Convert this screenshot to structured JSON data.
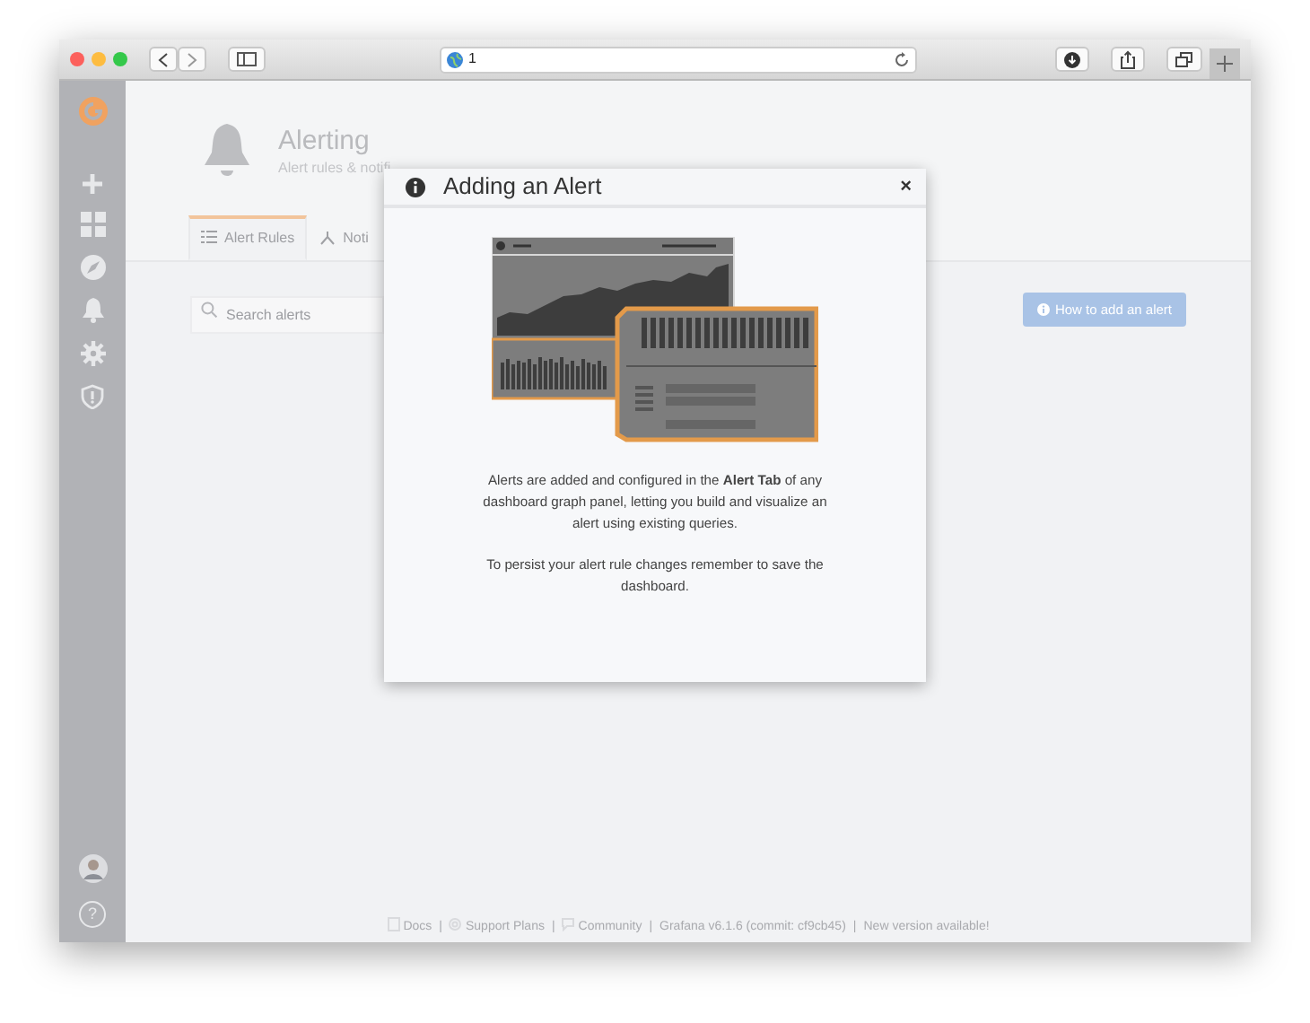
{
  "browser": {
    "url": "1"
  },
  "sidebar": {
    "help": "?"
  },
  "page": {
    "title": "Alerting",
    "subtitle": "Alert rules & notifi",
    "tabs": [
      {
        "label": "Alert Rules",
        "selected": true,
        "kind": "list"
      },
      {
        "label": "Noti",
        "selected": false,
        "kind": "channels"
      }
    ],
    "search": {
      "placeholder": "Search alerts"
    },
    "help_button": "How to add an alert"
  },
  "modal": {
    "title": "Adding an Alert",
    "close": "×",
    "paragraphs": [
      "Alerts are added and configured in the **Alert Tab** of any dashboard graph panel, letting you build and visualize an alert using existing queries.",
      "To persist your alert rule changes remember to save the dashboard."
    ]
  },
  "footer": {
    "separator": "|",
    "links": [
      {
        "label": "Docs",
        "kind": "docs"
      },
      {
        "label": "Support Plans",
        "kind": "support"
      },
      {
        "label": "Community",
        "kind": "community"
      },
      {
        "label": "Grafana v6.1.6 (commit: cf9cb45)",
        "kind": "plain"
      },
      {
        "label": "New version available!",
        "kind": "plain"
      }
    ]
  }
}
